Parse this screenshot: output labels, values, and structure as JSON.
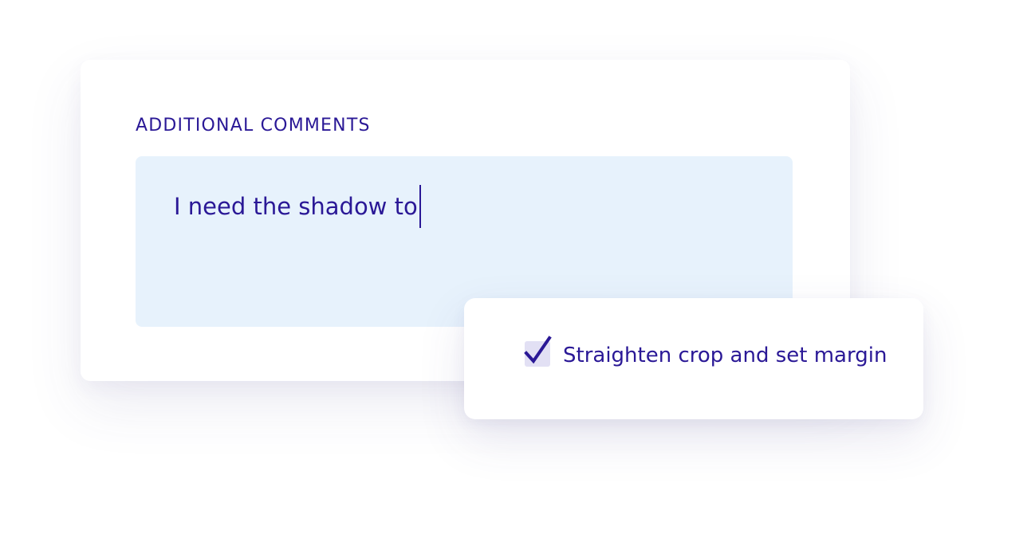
{
  "comments": {
    "label": "ADDITIONAL COMMENTS",
    "value": "I need the shadow to"
  },
  "task": {
    "checked": true,
    "label": "Straighten crop and set margin"
  },
  "colors": {
    "text": "#2a1896",
    "textarea_bg": "#e7f2fc",
    "checkbox_bg": "#e2e0f4"
  },
  "icons": {
    "checkbox": "checkmark-icon"
  }
}
